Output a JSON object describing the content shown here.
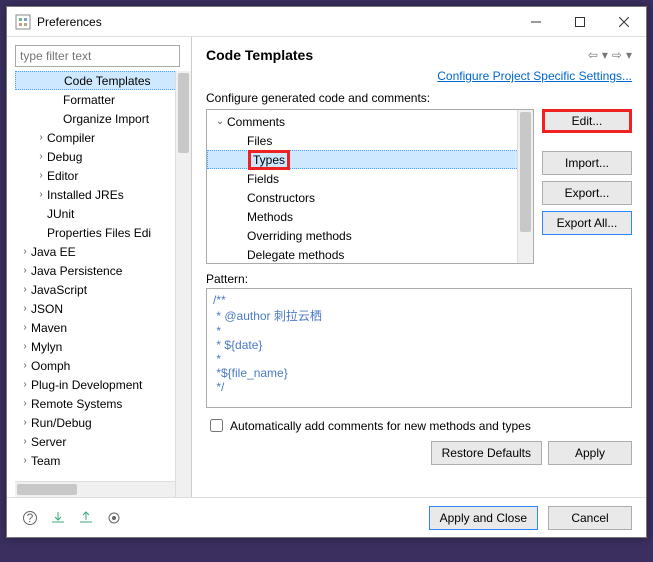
{
  "window": {
    "title": "Preferences"
  },
  "filter": {
    "placeholder": "type filter text"
  },
  "tree": [
    {
      "label": "Code Templates",
      "depth": 2,
      "arrow": "",
      "selected": true
    },
    {
      "label": "Formatter",
      "depth": 2,
      "arrow": ""
    },
    {
      "label": "Organize Import",
      "depth": 2,
      "arrow": ""
    },
    {
      "label": "Compiler",
      "depth": 1,
      "arrow": "closed"
    },
    {
      "label": "Debug",
      "depth": 1,
      "arrow": "closed"
    },
    {
      "label": "Editor",
      "depth": 1,
      "arrow": "closed"
    },
    {
      "label": "Installed JREs",
      "depth": 1,
      "arrow": "closed"
    },
    {
      "label": "JUnit",
      "depth": 1,
      "arrow": ""
    },
    {
      "label": "Properties Files Edi",
      "depth": 1,
      "arrow": ""
    },
    {
      "label": "Java EE",
      "depth": 0,
      "arrow": "closed"
    },
    {
      "label": "Java Persistence",
      "depth": 0,
      "arrow": "closed"
    },
    {
      "label": "JavaScript",
      "depth": 0,
      "arrow": "closed"
    },
    {
      "label": "JSON",
      "depth": 0,
      "arrow": "closed"
    },
    {
      "label": "Maven",
      "depth": 0,
      "arrow": "closed"
    },
    {
      "label": "Mylyn",
      "depth": 0,
      "arrow": "closed"
    },
    {
      "label": "Oomph",
      "depth": 0,
      "arrow": "closed"
    },
    {
      "label": "Plug-in Development",
      "depth": 0,
      "arrow": "closed"
    },
    {
      "label": "Remote Systems",
      "depth": 0,
      "arrow": "closed"
    },
    {
      "label": "Run/Debug",
      "depth": 0,
      "arrow": "closed"
    },
    {
      "label": "Server",
      "depth": 0,
      "arrow": "closed"
    },
    {
      "label": "Team",
      "depth": 0,
      "arrow": "closed"
    }
  ],
  "main": {
    "title": "Code Templates",
    "link": "Configure Project Specific Settings...",
    "section_label": "Configure generated code and comments:",
    "template_tree": [
      {
        "label": "Comments",
        "depth": 0,
        "arrow": "open"
      },
      {
        "label": "Files",
        "depth": 1
      },
      {
        "label": "Types",
        "depth": 1,
        "selected": true,
        "boxed": true
      },
      {
        "label": "Fields",
        "depth": 1
      },
      {
        "label": "Constructors",
        "depth": 1
      },
      {
        "label": "Methods",
        "depth": 1
      },
      {
        "label": "Overriding methods",
        "depth": 1
      },
      {
        "label": "Delegate methods",
        "depth": 1
      }
    ],
    "buttons": {
      "edit": "Edit...",
      "import": "Import...",
      "export": "Export...",
      "export_all": "Export All..."
    },
    "pattern_label": "Pattern:",
    "pattern_lines": [
      "/**",
      " * @author 刺拉云栖",
      " *",
      " * ${date}",
      " *",
      " *${file_name}",
      " */"
    ],
    "checkbox_label": "Automatically add comments for new methods and types",
    "restore_defaults": "Restore Defaults",
    "apply": "Apply"
  },
  "footer": {
    "apply_close": "Apply and Close",
    "cancel": "Cancel"
  }
}
